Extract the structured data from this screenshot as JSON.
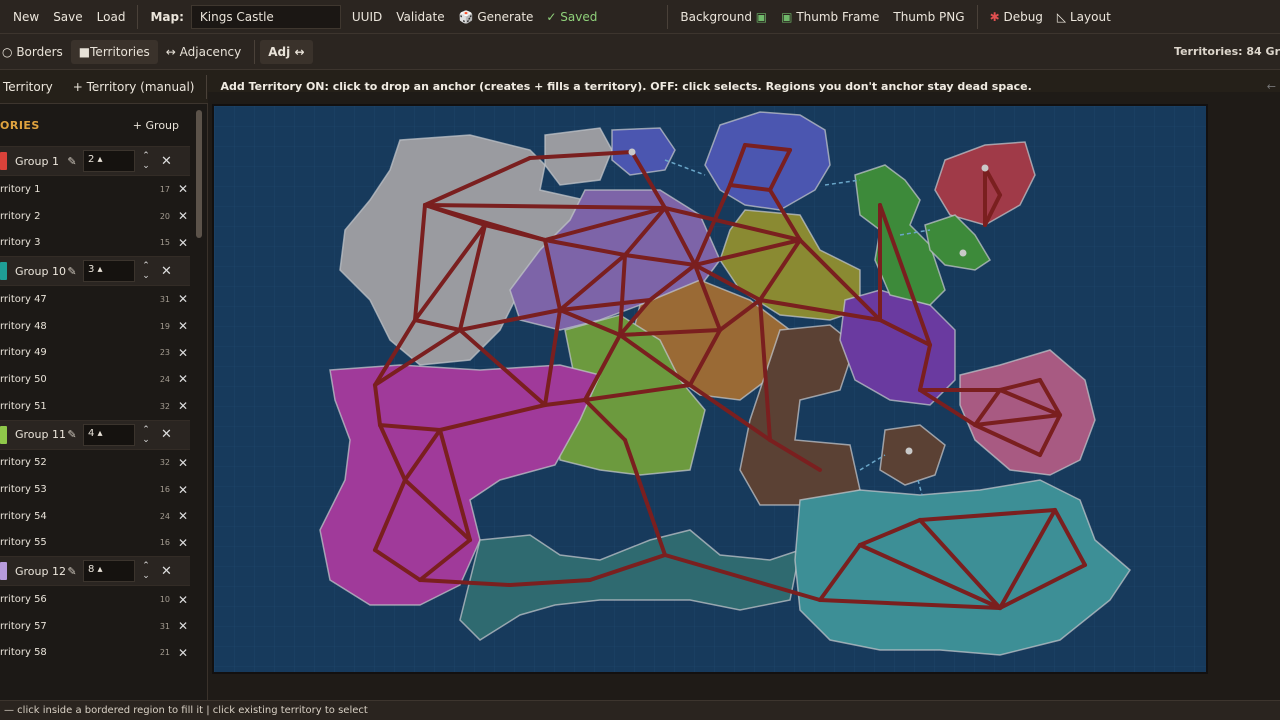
{
  "toolbar": {
    "new": "New",
    "save": "Save",
    "load": "Load",
    "map_label": "Map:",
    "map_name": "Kings Castle",
    "uuid": "UUID",
    "validate": "Validate",
    "generate": "Generate",
    "saved": "✓ Saved",
    "background": "Background",
    "thumb_frame": "Thumb Frame",
    "thumb_png": "Thumb PNG",
    "debug": "Debug",
    "layout": "Layout"
  },
  "modes": {
    "borders": "Borders",
    "territories": "Territories",
    "adjacency": "Adjacency",
    "adj": "Adj",
    "count": "Territories: 84  Gr"
  },
  "tools": {
    "territory": "Territory",
    "territory_manual": "+ Territory (manual)",
    "hint": "Add Territory ON: click to drop an anchor (creates + fills a territory).  OFF: click selects.  Regions you don't anchor stay dead space."
  },
  "sidebar": {
    "title": "ORIES",
    "add_group": "+ Group",
    "groups": [
      {
        "name": "Group 1",
        "color": "#d9423a",
        "count": "2",
        "territories": [
          {
            "name": "rritory 1",
            "num": "17"
          },
          {
            "name": "rritory 2",
            "num": "20"
          },
          {
            "name": "rritory 3",
            "num": "15"
          }
        ]
      },
      {
        "name": "Group 10",
        "color": "#1f9e96",
        "count": "3",
        "territories": [
          {
            "name": "rritory 47",
            "num": "31"
          },
          {
            "name": "rritory 48",
            "num": "19"
          },
          {
            "name": "rritory 49",
            "num": "23"
          },
          {
            "name": "rritory 50",
            "num": "24"
          },
          {
            "name": "rritory 51",
            "num": "32"
          }
        ]
      },
      {
        "name": "Group 11",
        "color": "#8fc84a",
        "count": "4",
        "territories": [
          {
            "name": "rritory 52",
            "num": "32"
          },
          {
            "name": "rritory 53",
            "num": "16"
          },
          {
            "name": "rritory 54",
            "num": "24"
          },
          {
            "name": "rritory 55",
            "num": "16"
          }
        ]
      },
      {
        "name": "Group 12",
        "color": "#b79bdc",
        "count": "8",
        "territories": [
          {
            "name": "rritory 56",
            "num": "10"
          },
          {
            "name": "rritory 57",
            "num": "31"
          },
          {
            "name": "rritory 58",
            "num": "21"
          }
        ]
      }
    ]
  },
  "status": {
    "text": "— click inside a bordered region to fill it  |  click existing territory to select"
  },
  "map_colors": {
    "ocean": "#173a5c",
    "gray": "#9a9ba0",
    "blue": "#4b56b0",
    "purple": "#7d64a8",
    "green": "#6c9a3e",
    "olive": "#8a8a32",
    "orange": "#9a6a35",
    "brown": "#5b4134",
    "violet": "#6a3aa0",
    "magenta": "#a03a9a",
    "pink": "#a85a82",
    "red": "#a03a48",
    "darkgreen": "#3d8a3a",
    "teal": "#2f6a70",
    "cyan": "#3d8f96",
    "link": "#7a1f1f"
  }
}
